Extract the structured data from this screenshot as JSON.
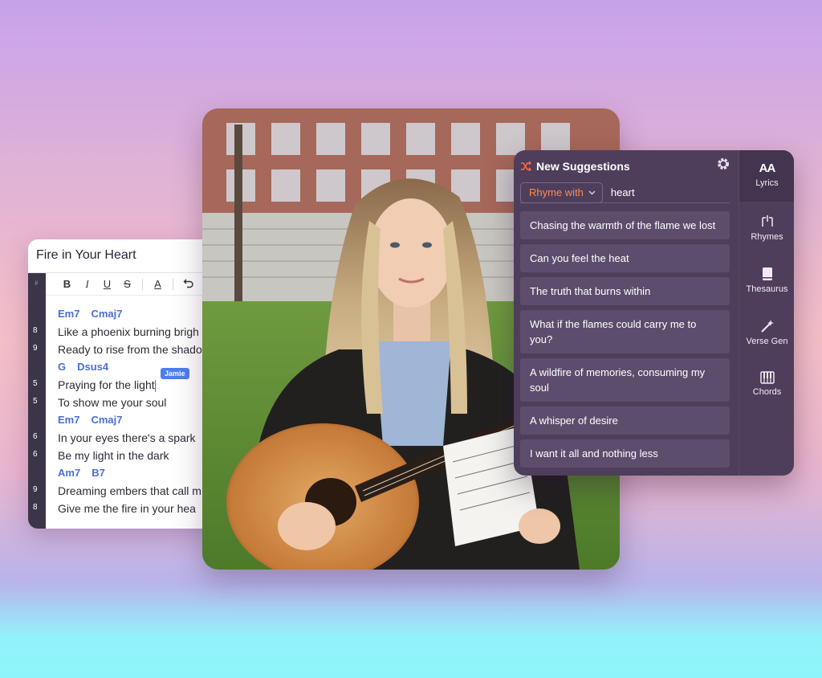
{
  "editor": {
    "title": "Fire in Your Heart",
    "gutter_hash": "#",
    "toolbar": {
      "bold": "B",
      "italic": "I",
      "underline": "U",
      "strike": "S",
      "color": "A"
    },
    "collaborator": "Jamie",
    "line_numbers": [
      "8",
      "9",
      "5",
      "5",
      "6",
      "6",
      "9",
      "8"
    ],
    "lines": {
      "chords1": [
        "Em7",
        "Cmaj7"
      ],
      "l1": "Like a phoenix burning brigh",
      "l2": "Ready to rise from the shado",
      "chords2": [
        "G",
        "Dsus4"
      ],
      "l3": "Praying for the light",
      "l4": "To show me your soul",
      "chords3": [
        "Em7",
        "Cmaj7"
      ],
      "l5": "In your eyes there's a spark",
      "l6": "Be my light in the dark",
      "chords4": [
        "Am7",
        "B7"
      ],
      "l7": "Dreaming embers that call m",
      "l8": "Give me the fire in your hea"
    }
  },
  "panel": {
    "title": "New Suggestions",
    "rhyme_mode": "Rhyme with",
    "rhyme_word": "heart",
    "suggestions": [
      "Chasing the warmth of the flame we lost",
      "Can you feel the heat",
      "The truth that burns within",
      "What if the flames could carry me to you?",
      "A wildfire of memories, consuming my soul",
      "A whisper of desire",
      "I want it all and nothing less"
    ],
    "rail": [
      {
        "label": "Lyrics",
        "glyph": "AA"
      },
      {
        "label": "Rhymes"
      },
      {
        "label": "Thesaurus"
      },
      {
        "label": "Verse Gen"
      },
      {
        "label": "Chords"
      }
    ]
  },
  "colors": {
    "accent_orange": "#ff8a4c",
    "chord_blue": "#4a6fd6",
    "panel_bg": "#4e3e5c"
  }
}
